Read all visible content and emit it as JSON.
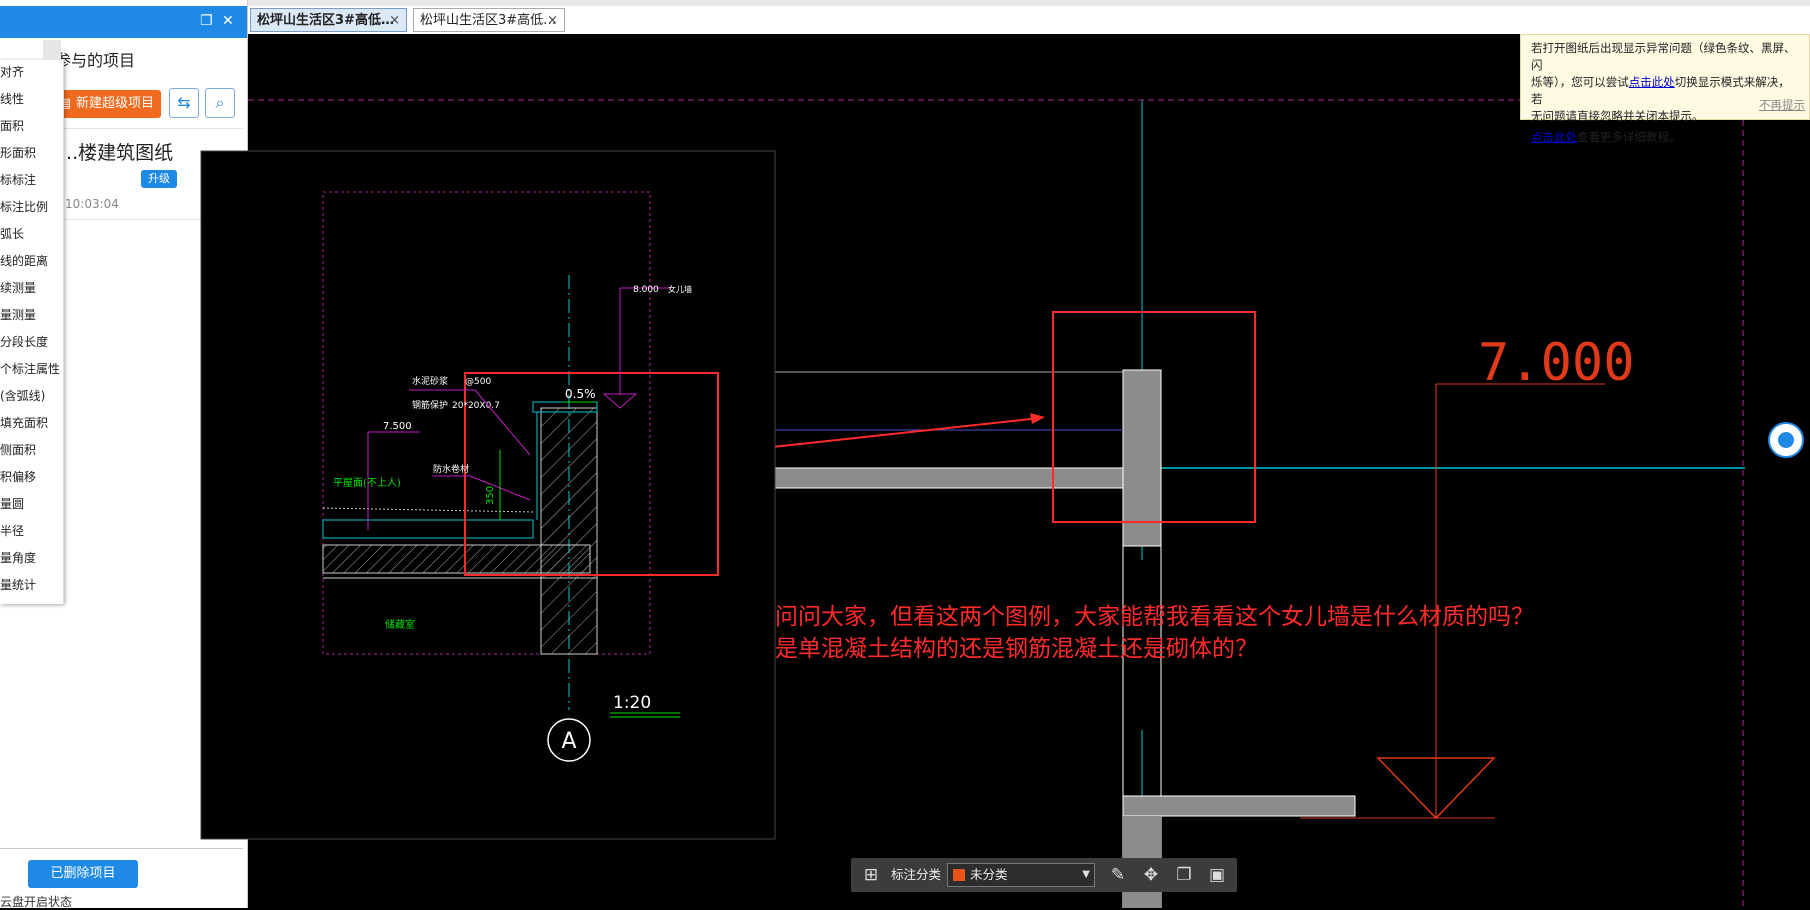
{
  "tabs": [
    {
      "label": "松坪山生活区3#高低…",
      "active": true
    },
    {
      "label": "松坪山生活区3#高低…",
      "active": false
    }
  ],
  "tab_close_glyph": "×",
  "left_panel": {
    "section_title": "参与的项目",
    "new_super_project": "新建超级项目",
    "project": {
      "name": "...楼建筑图纸",
      "upgrade": "升级",
      "time": "10:03:04"
    },
    "deleted_projects": "已删除项目",
    "bottom_status": "云盘开启状态"
  },
  "measure_menu": [
    "对齐",
    "线性",
    "面积",
    "形面积",
    "标标注",
    "标注比例",
    "弧长",
    "线的距离",
    "续测量",
    "量测量",
    "分段长度",
    "个标注属性",
    "(含弧线)",
    "填充面积",
    "侧面积",
    "积偏移",
    "量圆",
    "半径",
    "量角度",
    "量统计"
  ],
  "notice": {
    "line1": "若打开图纸后出现显示异常问题（绿色条纹、黑屏、闪",
    "line2_pre": "烁等），您可以尝试",
    "link1": "点击此处",
    "line2_post": "切换显示模式来解决，若",
    "line3": "无问题请直接忽略并关闭本提示。",
    "link2": "点击此处",
    "line4_post": "查看更多详细教程。",
    "dismiss": "不再提示"
  },
  "drawing": {
    "inset_labels": {
      "elev_top": "8.000",
      "elev_top_note": "女儿墙",
      "slope": "0.5%",
      "note1": "水泥砂浆",
      "note1_val": "@500",
      "note2": "钢筋保护",
      "note2_val": "20*20X0.7",
      "elev_mid": "7.500",
      "roof": "平屋面(不上人)",
      "anchor": "防水卷材",
      "dim": "350",
      "room": "储藏室",
      "scale": "1:20",
      "axis": "A"
    },
    "main_elevation": "7.000"
  },
  "question": {
    "line1": "问问大家，但看这两个图例，大家能帮我看看这个女儿墙是什么材质的吗？",
    "line2": "是单混凝土结构的还是钢筋混凝土还是砌体的？"
  },
  "toolbar": {
    "label": "标注分类",
    "selected": "未分类",
    "swatch_color": "#e8541a"
  },
  "colors": {
    "accent": "#1e8ae6",
    "orange": "#f06a1e",
    "cad_red": "#ff2a2a",
    "cad_cyan": "#00c8d2",
    "cad_magenta": "#c01ec0",
    "cad_green": "#00e000"
  }
}
